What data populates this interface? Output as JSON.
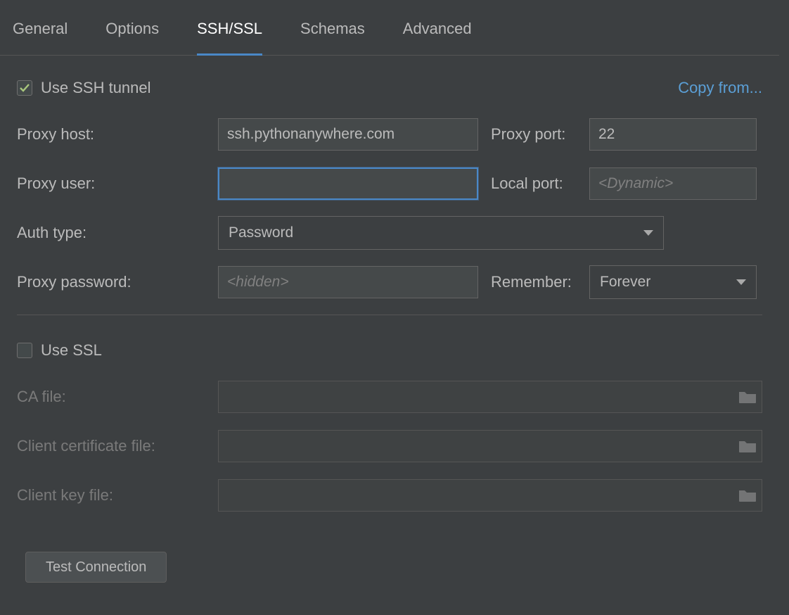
{
  "tabs": {
    "general": "General",
    "options": "Options",
    "sshssl": "SSH/SSL",
    "schemas": "Schemas",
    "advanced": "Advanced"
  },
  "ssh": {
    "use_tunnel_label": "Use SSH tunnel",
    "copy_from": "Copy from...",
    "proxy_host_label": "Proxy host:",
    "proxy_host_value": "ssh.pythonanywhere.com",
    "proxy_port_label": "Proxy port:",
    "proxy_port_value": "22",
    "proxy_user_label": "Proxy user:",
    "proxy_user_value": "",
    "local_port_label": "Local port:",
    "local_port_placeholder": "<Dynamic>",
    "auth_type_label": "Auth type:",
    "auth_type_value": "Password",
    "proxy_password_label": "Proxy password:",
    "proxy_password_placeholder": "<hidden>",
    "remember_label": "Remember:",
    "remember_value": "Forever"
  },
  "ssl": {
    "use_ssl_label": "Use SSL",
    "ca_file_label": "CA file:",
    "client_cert_label": "Client certificate file:",
    "client_key_label": "Client key file:"
  },
  "button": {
    "test_connection": "Test Connection"
  }
}
